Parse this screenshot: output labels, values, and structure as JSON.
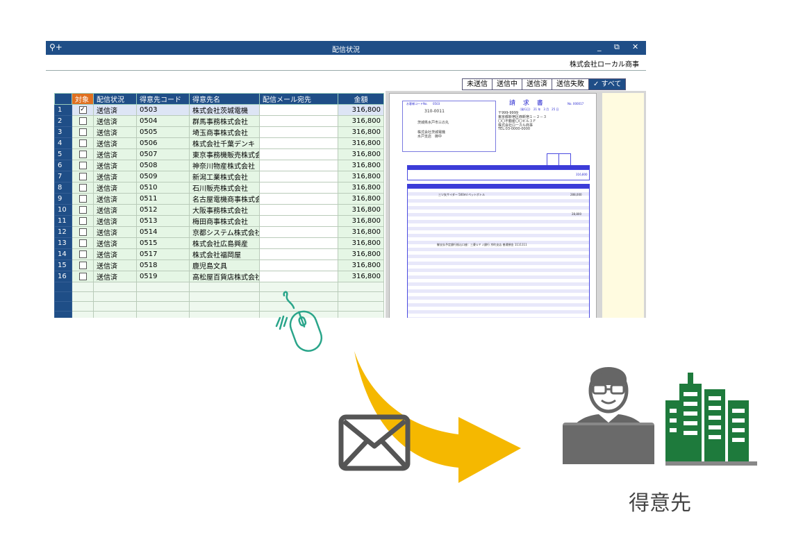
{
  "window": {
    "title": "配信状況",
    "company": "株式会社ローカル商事",
    "controls": [
      "_",
      "⧉",
      "✕"
    ]
  },
  "filters": [
    "未送信",
    "送信中",
    "送信済",
    "送信失敗",
    "✓ すべて"
  ],
  "grid": {
    "headers": [
      "",
      "対象",
      "配信状況",
      "得意先コード",
      "得意先名",
      "配信メール宛先",
      "金額"
    ],
    "rows": [
      {
        "no": "1",
        "checked": true,
        "status": "送信済",
        "code": "0503",
        "name": "株式会社茨城電機",
        "email": "",
        "amount": "316,800"
      },
      {
        "no": "2",
        "checked": false,
        "status": "送信済",
        "code": "0504",
        "name": "群馬事務株式会社",
        "email": "",
        "amount": "316,800"
      },
      {
        "no": "3",
        "checked": false,
        "status": "送信済",
        "code": "0505",
        "name": "埼玉商事株式会社",
        "email": "",
        "amount": "316,800"
      },
      {
        "no": "4",
        "checked": false,
        "status": "送信済",
        "code": "0506",
        "name": "株式会社千葉デンキ",
        "email": "",
        "amount": "316,800"
      },
      {
        "no": "5",
        "checked": false,
        "status": "送信済",
        "code": "0507",
        "name": "東京事務機販売株式会社",
        "email": "",
        "amount": "316,800"
      },
      {
        "no": "6",
        "checked": false,
        "status": "送信済",
        "code": "0508",
        "name": "神奈川物産株式会社",
        "email": "",
        "amount": "316,800"
      },
      {
        "no": "7",
        "checked": false,
        "status": "送信済",
        "code": "0509",
        "name": "新潟工業株式会社",
        "email": "",
        "amount": "316,800"
      },
      {
        "no": "8",
        "checked": false,
        "status": "送信済",
        "code": "0510",
        "name": "石川販売株式会社",
        "email": "",
        "amount": "316,800"
      },
      {
        "no": "9",
        "checked": false,
        "status": "送信済",
        "code": "0511",
        "name": "名古屋電機商事株式会社",
        "email": "",
        "amount": "316,800"
      },
      {
        "no": "10",
        "checked": false,
        "status": "送信済",
        "code": "0512",
        "name": "大阪事務株式会社",
        "email": "",
        "amount": "316,800"
      },
      {
        "no": "11",
        "checked": false,
        "status": "送信済",
        "code": "0513",
        "name": "梅田商事株式会社",
        "email": "",
        "amount": "316,800"
      },
      {
        "no": "12",
        "checked": false,
        "status": "送信済",
        "code": "0514",
        "name": "京都システム株式会社",
        "email": "",
        "amount": "316,800"
      },
      {
        "no": "13",
        "checked": false,
        "status": "送信済",
        "code": "0515",
        "name": "株式会社広島興産",
        "email": "",
        "amount": "316,800"
      },
      {
        "no": "14",
        "checked": false,
        "status": "送信済",
        "code": "0517",
        "name": "株式会社福岡屋",
        "email": "",
        "amount": "316,800"
      },
      {
        "no": "15",
        "checked": false,
        "status": "送信済",
        "code": "0518",
        "name": "鹿児島文具",
        "email": "",
        "amount": "316,800"
      },
      {
        "no": "16",
        "checked": false,
        "status": "送信済",
        "code": "0519",
        "name": "高松屋百貨店株式会社",
        "email": "",
        "amount": "316,800"
      }
    ],
    "empty_rows": 6
  },
  "invoice": {
    "title": "請 求 書",
    "customer_code_label": "お客様コードNo.",
    "customer_code": "0503",
    "postal": "310-0011",
    "address": "茨城県水戸市三の丸",
    "customer_name": "株式会社茨城電機",
    "branch": "水戸支店　御中",
    "sender_postal": "〒999-9999",
    "sender_address": "東京都新宿区西新宿１－２－３",
    "sender_building": "〇〇不動産〇〇ビル３Ｆ",
    "sender_company": "株式会社ローカル商事",
    "sender_tel": "TEL:03-0000-0000",
    "number": "No. 000017",
    "date": "（発行日）　21 年　3 月　25 日",
    "total": "316,800",
    "item_line": "三ツ矢サイダー 500ml ペットボトル",
    "item_amount": "288,000",
    "tax": "28,800",
    "bank_line": "御支払予定銀行振込口座：三菱ＵＦＪ銀行 京町支店 普通預金 1111111"
  },
  "illustration": {
    "caption": "得意先",
    "icons": [
      "mouse-icon",
      "envelope-icon",
      "curved-arrow-icon",
      "person-laptop-icon",
      "building-icon"
    ],
    "colors": {
      "arrow": "#f5b800",
      "mouse": "#2aa58a",
      "building": "#1e7a3c",
      "person": "#666666",
      "envelope": "#555555"
    }
  }
}
